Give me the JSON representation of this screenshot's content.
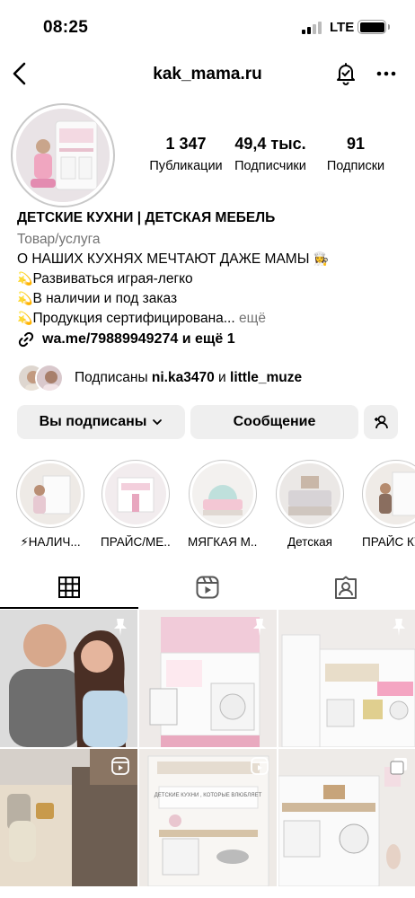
{
  "status": {
    "time": "08:25",
    "network": "LTE",
    "battery_level": 1.0
  },
  "header": {
    "username": "kak_mama.ru",
    "icons": [
      "back-icon",
      "notification-bell-icon",
      "more-icon"
    ]
  },
  "stats": [
    {
      "value": "1 347",
      "label": "Публикации"
    },
    {
      "value": "49,4 тыс.",
      "label": "Подписчики"
    },
    {
      "value": "91",
      "label": "Подписки"
    }
  ],
  "bio": {
    "name": "ДЕТСКИЕ КУХНИ | ДЕТСКАЯ МЕБЕЛЬ",
    "category": "Товар/услуга",
    "line1": "О НАШИХ КУХНЯХ МЕЧТАЮТ ДАЖЕ МАМЫ",
    "line1_emoji": "👩‍🍳",
    "bullet": "💫",
    "line2": "Развиваться играя-легко",
    "line3": "В наличии и под заказ",
    "line4": "Продукция сертифицирована...",
    "more": "ещё",
    "link": "wa.me/79889949274 и ещё 1"
  },
  "followed_by": {
    "prefix": "Подписаны",
    "user1": "ni.ka3470",
    "joiner": "и",
    "user2": "little_muze"
  },
  "buttons": {
    "following": "Вы подписаны",
    "message": "Сообщение"
  },
  "highlights": [
    {
      "label": "⚡НАЛИЧ..."
    },
    {
      "label": "ПРАЙС/МЕ..."
    },
    {
      "label": "МЯГКАЯ М..."
    },
    {
      "label": "Детская"
    },
    {
      "label": "ПРАЙС КУ"
    }
  ],
  "tabs": [
    {
      "name": "grid-icon",
      "active": true
    },
    {
      "name": "reels-icon",
      "active": false
    },
    {
      "name": "tagged-icon",
      "active": false
    }
  ],
  "posts": [
    {
      "description": "photo",
      "badge": "pin-icon"
    },
    {
      "description": "photo",
      "badge": "pin-icon"
    },
    {
      "description": "photo",
      "badge": "pin-icon"
    },
    {
      "description": "photo",
      "badge": "reel-icon"
    },
    {
      "description": "photo",
      "badge": "reel-icon",
      "overlay_text": "ДЕТСКИЕ КУХНИ , КОТОРЫЕ ВЛЮБЛЯЕТ"
    },
    {
      "description": "photo",
      "badge": "carousel-icon"
    }
  ],
  "colors": {
    "secondary_text": "#737373",
    "button_bg": "#efefef",
    "ring": "#c8c8c8"
  }
}
